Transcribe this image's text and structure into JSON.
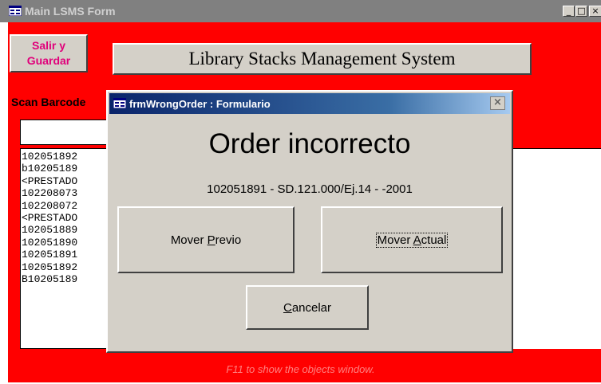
{
  "main_window": {
    "title": "Main LSMS Form",
    "controls": {
      "minimize": "_",
      "maximize": "□",
      "close": "×"
    }
  },
  "form": {
    "salir_button": "Salir y\nGuardar",
    "system_title": "Library Stacks Management System",
    "scan_label": "Scan Barcode",
    "scan_value": "",
    "barcodes": [
      "102051892",
      "b10205189",
      "<PRESTADO",
      "102208073",
      "102208072",
      "<PRESTADO",
      "102051889",
      "102051890",
      "102051891",
      "102051892",
      "B10205189"
    ],
    "f11_hint": "F11 to show the objects window."
  },
  "dialog": {
    "title": "frmWrongOrder : Formulario",
    "heading": "Order incorrecto",
    "info": "102051891 - SD.121.000/Ej.14 - -2001",
    "buttons": {
      "prev": {
        "before": "Mover ",
        "accel": "P",
        "after": "revio"
      },
      "actual": {
        "before": "Mover ",
        "accel": "A",
        "after": "ctual"
      },
      "cancel": {
        "before": "",
        "accel": "C",
        "after": "ancelar"
      }
    },
    "close_glyph": "×"
  },
  "colors": {
    "form_background": "#ff0000",
    "salir_text": "#e0007a",
    "dialog_title_start": "#0a246a",
    "dialog_title_end": "#a6caf0"
  }
}
